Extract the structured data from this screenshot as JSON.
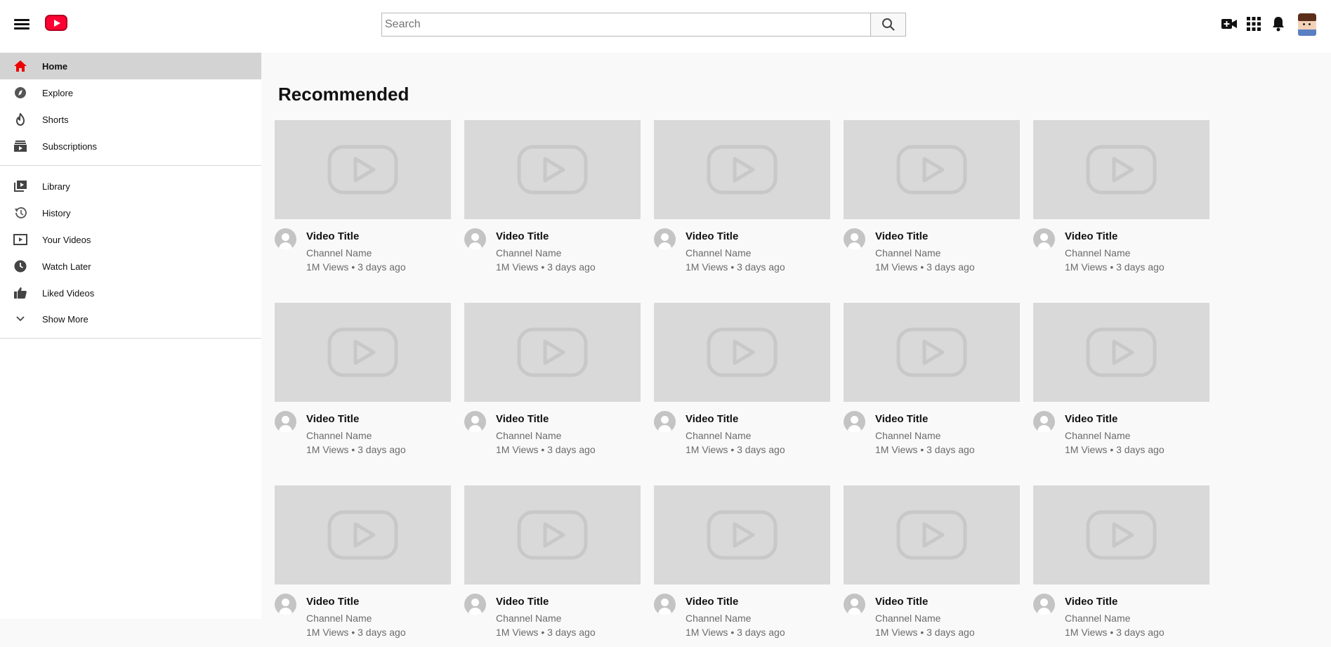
{
  "header": {
    "search_placeholder": "Search"
  },
  "sidebar": {
    "primary": [
      {
        "label": "Home",
        "icon": "home-icon",
        "active": true
      },
      {
        "label": "Explore",
        "icon": "compass-icon"
      },
      {
        "label": "Shorts",
        "icon": "shorts-icon"
      },
      {
        "label": "Subscriptions",
        "icon": "subscriptions-icon"
      }
    ],
    "secondary": [
      {
        "label": "Library",
        "icon": "library-icon"
      },
      {
        "label": "History",
        "icon": "history-icon"
      },
      {
        "label": "Your Videos",
        "icon": "your-videos-icon"
      },
      {
        "label": "Watch Later",
        "icon": "clock-icon"
      },
      {
        "label": "Liked Videos",
        "icon": "thumbs-up-icon"
      },
      {
        "label": "Show More",
        "icon": "chevron-down-icon"
      }
    ]
  },
  "main": {
    "section_title": "Recommended",
    "videos": [
      {
        "title": "Video Title",
        "channel": "Channel Name",
        "meta": "1M Views • 3 days ago"
      },
      {
        "title": "Video Title",
        "channel": "Channel Name",
        "meta": "1M Views • 3 days ago"
      },
      {
        "title": "Video Title",
        "channel": "Channel Name",
        "meta": "1M Views • 3 days ago"
      },
      {
        "title": "Video Title",
        "channel": "Channel Name",
        "meta": "1M Views • 3 days ago"
      },
      {
        "title": "Video Title",
        "channel": "Channel Name",
        "meta": "1M Views • 3 days ago"
      },
      {
        "title": "Video Title",
        "channel": "Channel Name",
        "meta": "1M Views • 3 days ago"
      },
      {
        "title": "Video Title",
        "channel": "Channel Name",
        "meta": "1M Views • 3 days ago"
      },
      {
        "title": "Video Title",
        "channel": "Channel Name",
        "meta": "1M Views • 3 days ago"
      },
      {
        "title": "Video Title",
        "channel": "Channel Name",
        "meta": "1M Views • 3 days ago"
      },
      {
        "title": "Video Title",
        "channel": "Channel Name",
        "meta": "1M Views • 3 days ago"
      },
      {
        "title": "Video Title",
        "channel": "Channel Name",
        "meta": "1M Views • 3 days ago"
      },
      {
        "title": "Video Title",
        "channel": "Channel Name",
        "meta": "1M Views • 3 days ago"
      },
      {
        "title": "Video Title",
        "channel": "Channel Name",
        "meta": "1M Views • 3 days ago"
      },
      {
        "title": "Video Title",
        "channel": "Channel Name",
        "meta": "1M Views • 3 days ago"
      },
      {
        "title": "Video Title",
        "channel": "Channel Name",
        "meta": "1M Views • 3 days ago"
      }
    ]
  },
  "colors": {
    "brand_red": "#ff0033",
    "active_bg": "#d3d3d3",
    "thumb_bg": "#d9d9d9"
  }
}
